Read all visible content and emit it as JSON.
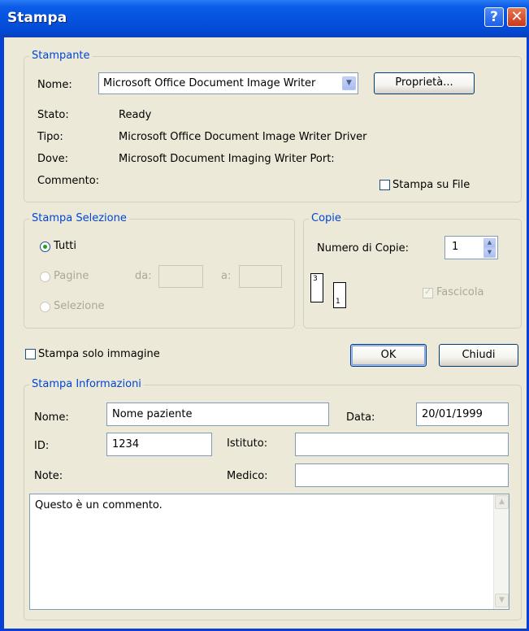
{
  "window": {
    "title": "Stampa",
    "help_glyph": "?",
    "close_glyph": "✕"
  },
  "printer": {
    "legend": "Stampante",
    "name_label": "Nome:",
    "name_value": "Microsoft Office Document Image Writer",
    "properties_button": "Proprietà...",
    "status_label": "Stato:",
    "status_value": "Ready",
    "type_label": "Tipo:",
    "type_value": "Microsoft Office Document Image Writer Driver",
    "where_label": "Dove:",
    "where_value": "Microsoft Document Imaging Writer Port:",
    "comment_label": "Commento:",
    "print_to_file_label": "Stampa su File",
    "print_to_file_checked": false
  },
  "range": {
    "legend": "Stampa Selezione",
    "all_label": "Tutti",
    "pages_label": "Pagine",
    "from_label": "da:",
    "to_label": "a:",
    "from_value": "",
    "to_value": "",
    "selection_label": "Selezione",
    "selected": "all"
  },
  "copies": {
    "legend": "Copie",
    "count_label": "Numero di Copie:",
    "count_value": "1",
    "collate_label": "Fascicola",
    "collate_checked": true,
    "icon_page_back": "3",
    "icon_page_front": "1"
  },
  "image_only": {
    "label": "Stampa solo immagine",
    "checked": false
  },
  "buttons": {
    "ok": "OK",
    "close": "Chiudi"
  },
  "info": {
    "legend": "Stampa Informazioni",
    "name_label": "Nome:",
    "name_value": "Nome paziente",
    "date_label": "Data:",
    "date_value": "20/01/1999",
    "id_label": "ID:",
    "id_value": "1234",
    "institute_label": "Istituto:",
    "institute_value": "",
    "notes_label": "Note:",
    "doctor_label": "Medico:",
    "doctor_value": "",
    "comment_text": "Questo è un commento."
  },
  "colors": {
    "title_bar": "#0553df",
    "dialog_bg": "#ece9d8",
    "group_legend": "#0046d5",
    "radio_dot": "#21a121"
  }
}
